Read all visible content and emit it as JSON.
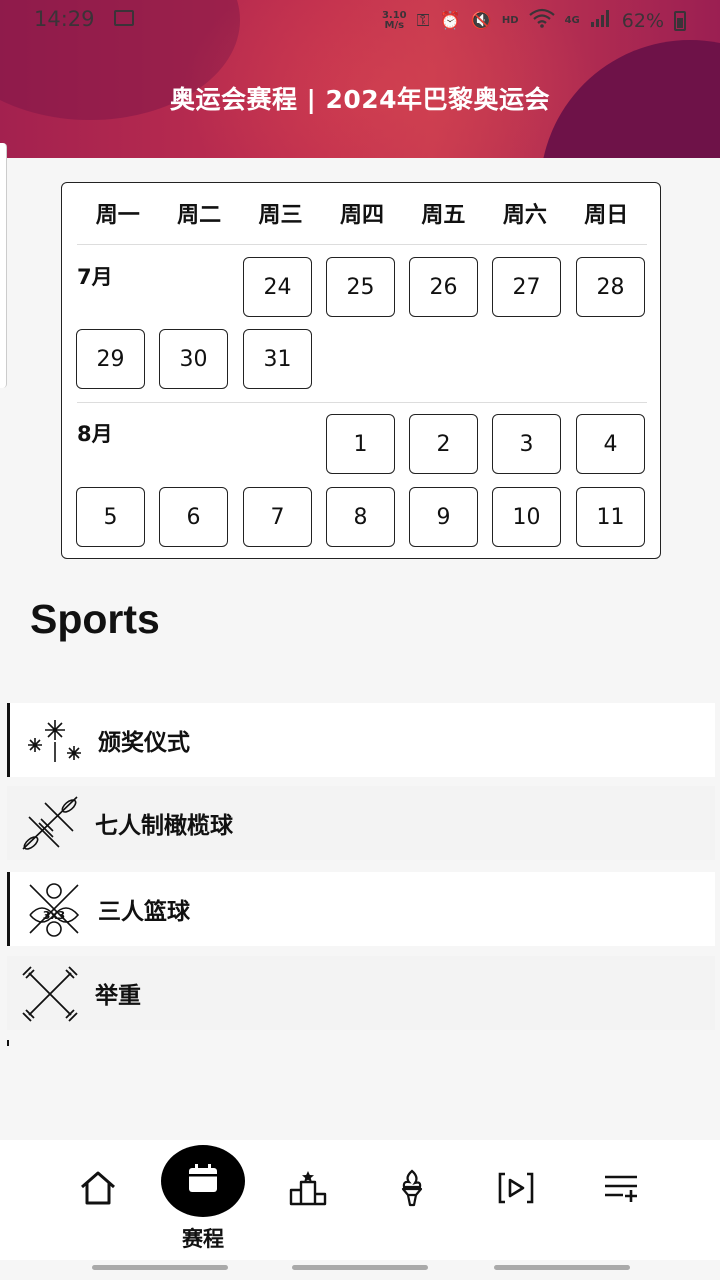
{
  "status_bar": {
    "time": "14:29",
    "net_speed_value": "3.10",
    "net_speed_unit": "M/s",
    "hd": "HD",
    "network": "4G",
    "battery": "62%"
  },
  "header": {
    "title": "奥运会赛程 | 2024年巴黎奥运会"
  },
  "calendar": {
    "weekdays": [
      "周一",
      "周二",
      "周三",
      "周四",
      "周五",
      "周六",
      "周日"
    ],
    "months": [
      {
        "label": "7月",
        "days": [
          "24",
          "25",
          "26",
          "27",
          "28",
          "29",
          "30",
          "31"
        ]
      },
      {
        "label": "8月",
        "days": [
          "1",
          "2",
          "3",
          "4",
          "5",
          "6",
          "7",
          "8",
          "9",
          "10",
          "11"
        ]
      }
    ]
  },
  "sports": {
    "heading": "Sports",
    "items": [
      {
        "label": "颁奖仪式",
        "icon": "fireworks-icon"
      },
      {
        "label": "七人制橄榄球",
        "icon": "rugby-sevens-icon"
      },
      {
        "label": "三人篮球",
        "icon": "basketball-3x3-icon"
      },
      {
        "label": "举重",
        "icon": "weightlifting-icon"
      }
    ]
  },
  "bottom_nav": {
    "items": [
      {
        "icon": "home-icon"
      },
      {
        "icon": "calendar-icon",
        "label": "赛程",
        "active": true
      },
      {
        "icon": "podium-icon"
      },
      {
        "icon": "torch-icon"
      },
      {
        "icon": "play-icon"
      },
      {
        "icon": "playlist-add-icon"
      }
    ]
  }
}
